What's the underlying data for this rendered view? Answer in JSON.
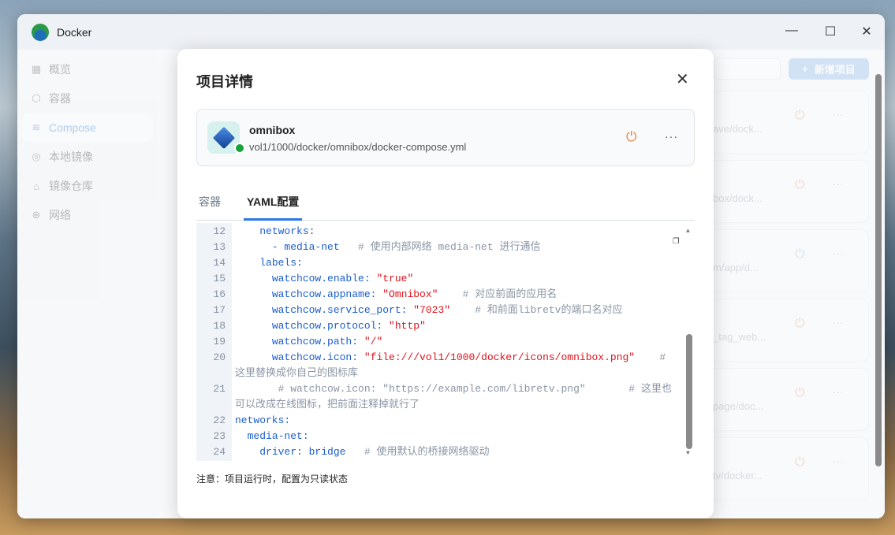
{
  "window": {
    "title": "Docker",
    "controls": [
      "—",
      "☐",
      "✕"
    ]
  },
  "sidebar": {
    "items": [
      {
        "label": "概览",
        "icon": "▦"
      },
      {
        "label": "容器",
        "icon": "⬡"
      },
      {
        "label": "Compose",
        "icon": "≋",
        "active": true
      },
      {
        "label": "本地镜像",
        "icon": "◎"
      },
      {
        "label": "镜像仓库",
        "icon": "⌂"
      },
      {
        "label": "网络",
        "icon": "⊕"
      }
    ]
  },
  "main": {
    "add_button": "新增项目",
    "add_icon": "+",
    "projects": [
      {
        "path": "ave/dock..."
      },
      {
        "path": "box/dock..."
      },
      {
        "path": "m/app/d...",
        "stopped": true
      },
      {
        "path": "_tag_web..."
      },
      {
        "path": "page/doc..."
      },
      {
        "path": "tv/docker..."
      }
    ]
  },
  "modal": {
    "title": "项目详情",
    "close": "✕",
    "project": {
      "name": "omnibox",
      "path": "vol1/1000/docker/omnibox/docker-compose.yml",
      "status_color": "#18a33a"
    },
    "tabs": [
      "容器",
      "YAML配置"
    ],
    "active_tab": 1,
    "note": "注意：项目运行时，配置为只读状态",
    "code": [
      {
        "n": "12",
        "t": [
          [
            "k",
            "    networks:"
          ]
        ]
      },
      {
        "n": "13",
        "t": [
          [
            "p",
            "      - media-net"
          ],
          [
            "c",
            "   # 使用内部网络 media-net 进行通信"
          ]
        ]
      },
      {
        "n": "14",
        "t": [
          [
            "k",
            "    labels:"
          ]
        ]
      },
      {
        "n": "15",
        "t": [
          [
            "k",
            "      watchcow.enable: "
          ],
          [
            "s",
            "\"true\""
          ]
        ]
      },
      {
        "n": "16",
        "t": [
          [
            "k",
            "      watchcow.appname: "
          ],
          [
            "s",
            "\"Omnibox\""
          ],
          [
            "c",
            "    # 对应前面的应用名"
          ]
        ]
      },
      {
        "n": "17",
        "t": [
          [
            "k",
            "      watchcow.service_port: "
          ],
          [
            "s",
            "\"7023\""
          ],
          [
            "c",
            "    # 和前面libretv的端口名对应"
          ]
        ]
      },
      {
        "n": "18",
        "t": [
          [
            "k",
            "      watchcow.protocol: "
          ],
          [
            "s",
            "\"http\""
          ]
        ]
      },
      {
        "n": "19",
        "t": [
          [
            "k",
            "      watchcow.path: "
          ],
          [
            "s",
            "\"/\""
          ]
        ]
      },
      {
        "n": "20",
        "t": [
          [
            "k",
            "      watchcow.icon: "
          ],
          [
            "s",
            "\"file:///vol1/1000/docker/icons/omnibox.png\""
          ],
          [
            "c",
            "    # 这里替换成你自己的图标库"
          ]
        ]
      },
      {
        "n": "21",
        "t": [
          [
            "c",
            "       # watchcow.icon: \"https://example.com/libretv.png\"       # 这里也可以改成在线图标，把前面注释掉就行了"
          ]
        ]
      },
      {
        "n": "22",
        "t": [
          [
            "k",
            "networks:"
          ]
        ]
      },
      {
        "n": "23",
        "t": [
          [
            "k",
            "  media-net:"
          ]
        ]
      },
      {
        "n": "24",
        "t": [
          [
            "k",
            "    driver: bridge"
          ],
          [
            "c",
            "   # 使用默认的桥接网络驱动"
          ]
        ]
      }
    ]
  }
}
